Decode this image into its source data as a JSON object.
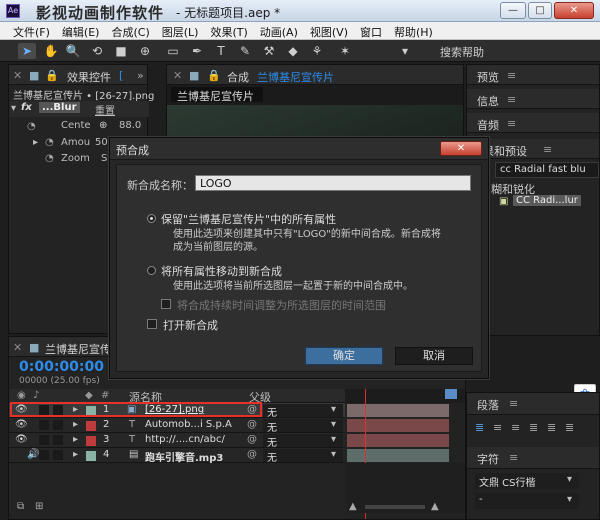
{
  "window": {
    "watermark": "影视动画制作软件",
    "doc_title": "- 无标题项目.aep *",
    "minimize": "—",
    "maximize": "□",
    "close": "✕"
  },
  "menubar": [
    "文件(F)",
    "编辑(E)",
    "合成(C)",
    "图层(L)",
    "效果(T)",
    "动画(A)",
    "视图(V)",
    "窗口",
    "帮助(H)"
  ],
  "toolbar": {
    "search_help": "搜索帮助"
  },
  "effects_panel": {
    "title": "效果控件",
    "title_tag": "[",
    "layer_path": "兰博基尼宣传片 • [26-27].png",
    "fx_label": "fx",
    "effect_name": "...Blur",
    "reset": "重置",
    "props": [
      {
        "name": "Cente",
        "value": "88.0"
      },
      {
        "name": "Amou",
        "value": "50."
      },
      {
        "name": "Zoom",
        "value": "St"
      }
    ]
  },
  "comp_panel": {
    "title": "合成",
    "comp_name": "兰博基尼宣传片",
    "tab": "兰博基尼宣传片"
  },
  "right_panels": {
    "preview": "预览",
    "info": "信息",
    "audio": "音频",
    "effects_presets": "果和预设",
    "search_value": "cc Radial fast blu",
    "category": "糊和锐化",
    "result": "CC Radi...lur",
    "paragraph": "段落",
    "character": "字符",
    "font": "文鼎 CS行楷"
  },
  "dialog": {
    "title": "预合成",
    "name_label": "新合成名称：",
    "name_value": "LOGO",
    "option1_title": "保留\"兰博基尼宣传片\"中的所有属性",
    "option1_desc1": "使用此选项来创建其中只有\"LOGO\"的新中间合成。新合成将",
    "option1_desc2": "成为当前图层的源。",
    "option2_title": "将所有属性移动到新合成",
    "option2_desc": "使用此选项将当前所选图层一起置于新的中间合成中。",
    "adjust_duration": "将合成持续时间调整为所选图层的时间范围",
    "open_new": "打开新合成",
    "ok": "确定",
    "cancel": "取消"
  },
  "timeline": {
    "title": "兰博基尼宣传片",
    "timecode": "0:00:00:00",
    "fps": "00000 (25.00 fps)",
    "col_source": "源名称",
    "col_parent": "父级",
    "rows": [
      {
        "num": "1",
        "name": "[26-27].png",
        "parent": "无",
        "color": "#8ab3a6"
      },
      {
        "num": "2",
        "name": "Automob...i S.p.A",
        "parent": "无",
        "color": "#c03b3b"
      },
      {
        "num": "3",
        "name": "http://....cn/abc/",
        "parent": "无",
        "color": "#c03b3b"
      },
      {
        "num": "4",
        "name": "跑车引擎音.mp3",
        "parent": "无",
        "color": "#8ab3a6"
      }
    ]
  },
  "colors": {
    "accent_blue": "#2d8ceb",
    "highlight_red": "#e8302a",
    "ok_button": "#3c6e9e"
  }
}
